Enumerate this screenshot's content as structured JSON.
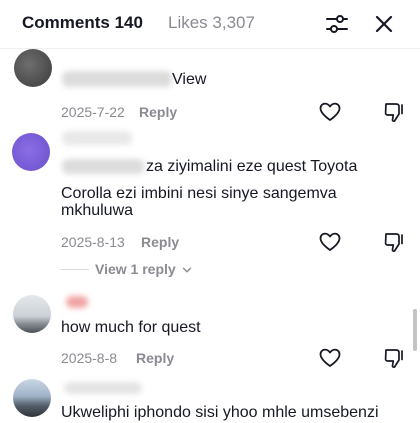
{
  "header": {
    "comments_tab": "Comments 140",
    "likes_tab": "Likes 3,307"
  },
  "comments": [
    {
      "text": "View",
      "date": "2025-7-22",
      "reply_label": "Reply"
    },
    {
      "text_line1": "za ziyimalini eze quest Toyota",
      "text_line2": "Corolla ezi imbini nesi sinye sangemva",
      "text_line3": "mkhuluwa",
      "date": "2025-8-13",
      "reply_label": "Reply",
      "view_replies": "View 1 reply"
    },
    {
      "text": "how much for quest",
      "date": "2025-8-8",
      "reply_label": "Reply"
    },
    {
      "text": "Ukweliphi iphondo sisi yhoo mhle umsebenzi"
    }
  ],
  "colors": {
    "text": "#161823",
    "muted": "#8a8b91",
    "avatar_purple": "#7b5cd6"
  },
  "icons": [
    "filter-sliders-icon",
    "close-icon",
    "heart-icon",
    "thumbs-down-icon",
    "chevron-down-icon"
  ]
}
